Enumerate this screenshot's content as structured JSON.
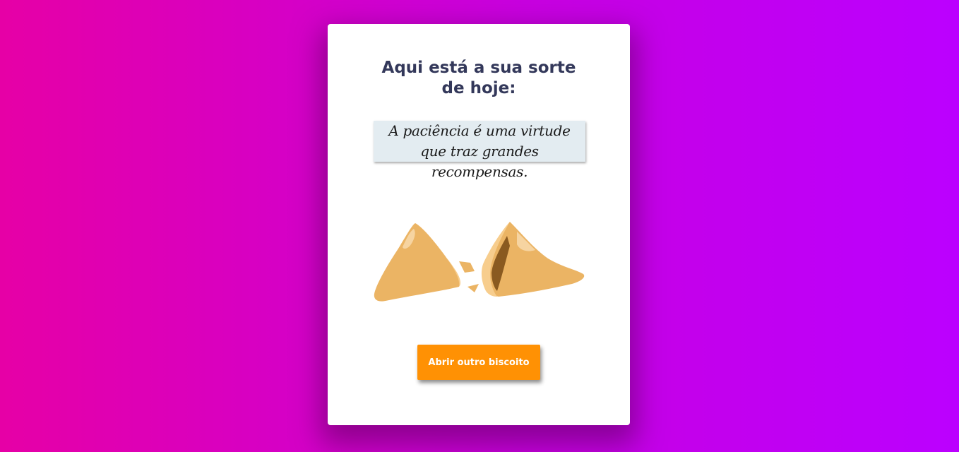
{
  "card": {
    "title": "Aqui está a sua sorte de hoje:",
    "fortune": "A paciência é uma virtude que traz grandes recompensas.",
    "cookie_image": "broken-fortune-cookie-icon",
    "button_label": "Abrir outro biscoito"
  },
  "colors": {
    "background_start": "#e600a6",
    "background_end": "#bb00ff",
    "card": "#ffffff",
    "title": "#33385a",
    "fortune_paper": "#e3ecf1",
    "button": "#ff9104",
    "cookie": "#ebb464"
  }
}
